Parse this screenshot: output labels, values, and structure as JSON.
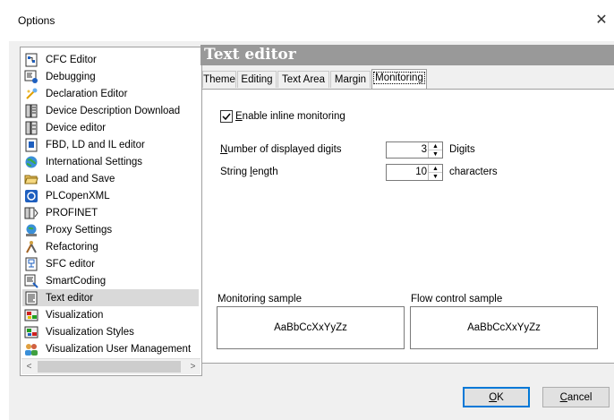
{
  "window": {
    "title": "Options",
    "close_glyph": "✕"
  },
  "tree": {
    "items": [
      {
        "label": "CFC Editor",
        "icon": "cfc-editor-icon"
      },
      {
        "label": "Debugging",
        "icon": "debugging-icon"
      },
      {
        "label": "Declaration Editor",
        "icon": "declaration-editor-icon"
      },
      {
        "label": "Device Description Download",
        "icon": "device-description-icon"
      },
      {
        "label": "Device editor",
        "icon": "device-editor-icon"
      },
      {
        "label": "FBD, LD and IL editor",
        "icon": "fbd-ld-il-icon"
      },
      {
        "label": "International Settings",
        "icon": "globe-icon"
      },
      {
        "label": "Load and Save",
        "icon": "folder-open-icon"
      },
      {
        "label": "PLCopenXML",
        "icon": "plcopenxml-icon"
      },
      {
        "label": "PROFINET",
        "icon": "profinet-icon"
      },
      {
        "label": "Proxy Settings",
        "icon": "proxy-icon"
      },
      {
        "label": "Refactoring",
        "icon": "refactoring-icon"
      },
      {
        "label": "SFC editor",
        "icon": "sfc-editor-icon"
      },
      {
        "label": "SmartCoding",
        "icon": "smartcoding-icon"
      },
      {
        "label": "Text editor",
        "icon": "text-editor-icon",
        "selected": true
      },
      {
        "label": "Visualization",
        "icon": "visualization-icon"
      },
      {
        "label": "Visualization Styles",
        "icon": "visualization-styles-icon"
      },
      {
        "label": "Visualization User Management",
        "icon": "users-icon"
      }
    ],
    "scroll_left": "<",
    "scroll_right": ">"
  },
  "panel": {
    "heading": "Text editor",
    "tabs": [
      "Theme",
      "Editing",
      "Text Area",
      "Margin",
      "Monitoring"
    ],
    "active_tab": "Monitoring",
    "enable_inline_monitoring": {
      "label_accel": "E",
      "label_rest": "nable inline monitoring",
      "checked": true
    },
    "digits": {
      "label_pre": "N",
      "label_rest": "umber of displayed digits",
      "value": "3",
      "unit": "Digits"
    },
    "string_length": {
      "label_pre": "String ",
      "label_accel": "l",
      "label_rest": "ength",
      "value": "10",
      "unit": "characters"
    },
    "monitoring_sample": {
      "label": "Monitoring sample",
      "text": "AaBbCcXxYyZz"
    },
    "flow_sample": {
      "label": "Flow control sample",
      "text": "AaBbCcXxYyZz"
    }
  },
  "buttons": {
    "ok": {
      "accel": "O",
      "rest": "K"
    },
    "cancel": {
      "accel": "C",
      "rest": "ancel"
    }
  },
  "colors": {
    "header_bg": "#999999",
    "selection_bg": "#d9d9d9",
    "default_button_border": "#0078d7"
  }
}
